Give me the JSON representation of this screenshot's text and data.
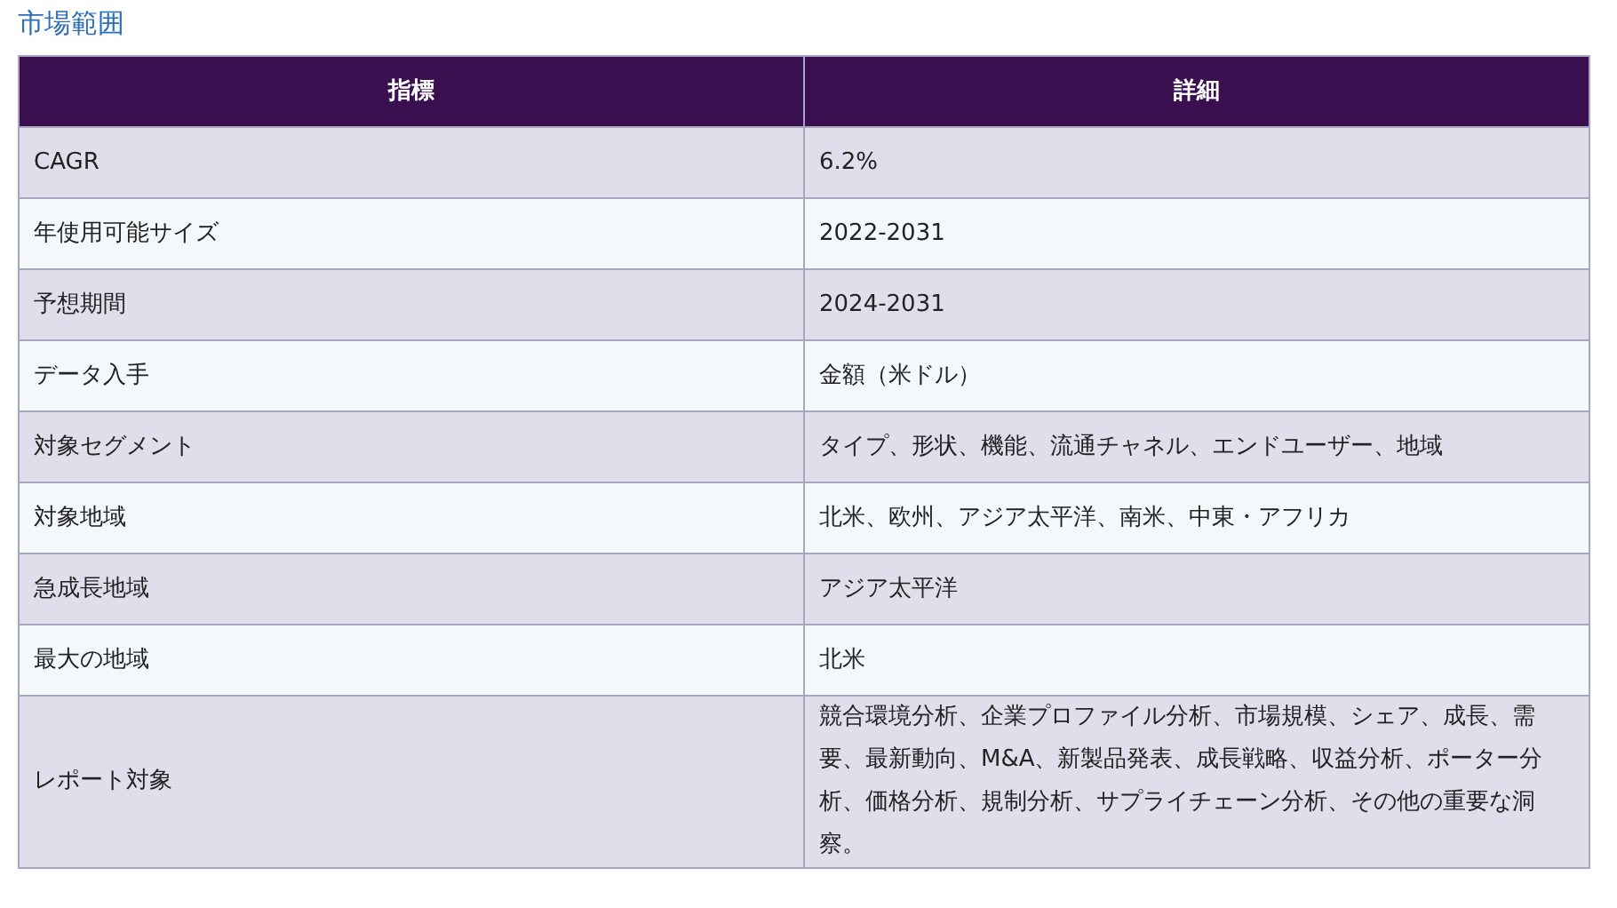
{
  "title": "市場範囲",
  "table": {
    "columns": [
      "指標",
      "詳細"
    ],
    "rows": [
      [
        "CAGR",
        "6.2%"
      ],
      [
        "年使用可能サイズ",
        "2022-2031"
      ],
      [
        "予想期間",
        "2024-2031"
      ],
      [
        "データ入手",
        "金額（米ドル）"
      ],
      [
        "対象セグメント",
        "タイプ、形状、機能、流通チャネル、エンドユーザー、地域"
      ],
      [
        "対象地域",
        "北米、欧州、アジア太平洋、南米、中東・アフリカ"
      ],
      [
        "急成長地域",
        "アジア太平洋"
      ],
      [
        "最大の地域",
        "北米"
      ],
      [
        "レポート対象",
        "競合環境分析、企業プロファイル分析、市場規模、シェア、成長、需要、最新動向、M&A、新製品発表、成長戦略、収益分析、ポーター分析、価格分析、規制分析、サプライチェーン分析、その他の重要な洞察。"
      ]
    ]
  }
}
